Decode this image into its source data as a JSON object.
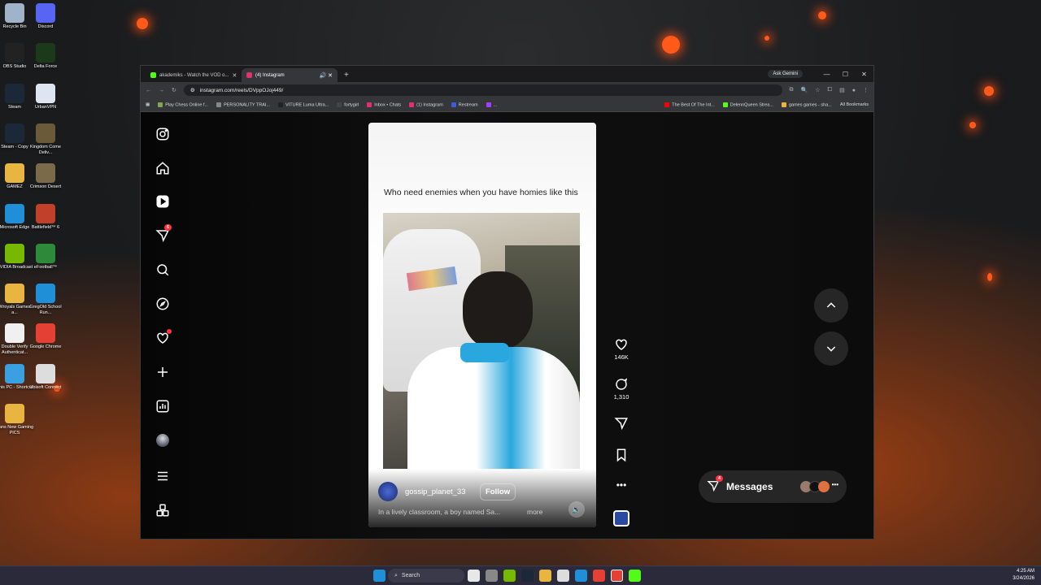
{
  "desktop": {
    "icons": [
      {
        "label": "Recycle Bin",
        "color": "#9fb4c8"
      },
      {
        "label": "Discord",
        "color": "#5865f2"
      },
      {
        "label": "OBS Studio",
        "color": "#222"
      },
      {
        "label": "Delta Force",
        "color": "#1a3a1a"
      },
      {
        "label": "Steam",
        "color": "#1b2838"
      },
      {
        "label": "UrbanVPN",
        "color": "#dde6f0"
      },
      {
        "label": "Steam - Copy",
        "color": "#1b2838"
      },
      {
        "label": "Kingdom Come Deliv...",
        "color": "#6b5a3a"
      },
      {
        "label": "GAMEZ",
        "color": "#e8b640"
      },
      {
        "label": "Crimson Desert",
        "color": "#7a6a4a"
      },
      {
        "label": "Microsoft Edge",
        "color": "#1f8fd8"
      },
      {
        "label": "Battlefield™ 6",
        "color": "#c0402a"
      },
      {
        "label": "NVIDIA Broadcast",
        "color": "#76b900"
      },
      {
        "label": "eFootball™",
        "color": "#2d8a3a"
      },
      {
        "label": "Wroyals Games a...",
        "color": "#e8b640"
      },
      {
        "label": "GregOld School Run...",
        "color": "#1f8fd8"
      },
      {
        "label": "Double Verify Authenticat...",
        "color": "#f0f0f0"
      },
      {
        "label": "Google Chrome",
        "color": "#e44134"
      },
      {
        "label": "This PC - Shortcut",
        "color": "#3aa0e0"
      },
      {
        "label": "Ubisoft Connect",
        "color": "#dddddd"
      },
      {
        "label": "Dans New Gaming PICS",
        "color": "#e8b640"
      }
    ]
  },
  "browser": {
    "tabs": [
      {
        "title": "akademiks - Watch the VOD o...",
        "active": false,
        "color": "#53fc18"
      },
      {
        "title": "(4) Instagram",
        "active": true,
        "color": "#e1306c"
      }
    ],
    "ask_gemini": "Ask Gemini",
    "url": "instagram.com/reels/DVppOJoj449/",
    "bookmarks": [
      {
        "label": "Play Chess Online f...",
        "color": "#7fa650"
      },
      {
        "label": "PERSONALITY TRAI...",
        "color": "#888"
      },
      {
        "label": "VITURE Luma Ultra...",
        "color": "#222"
      },
      {
        "label": "fortygirl",
        "color": "#444"
      },
      {
        "label": "Inbox • Chats",
        "color": "#e1306c"
      },
      {
        "label": "(1) Instagram",
        "color": "#e1306c"
      },
      {
        "label": "Restream",
        "color": "#3b5bdb"
      },
      {
        "label": "...",
        "color": "#a040ff"
      },
      {
        "label": "The Best Of The Int...",
        "color": "#ff0000"
      },
      {
        "label": "DelennQueen Strea...",
        "color": "#53fc18"
      },
      {
        "label": "games games - sha...",
        "color": "#e8b640"
      }
    ],
    "all_bookmarks": "All Bookmarks"
  },
  "instagram": {
    "nav_badge": "6",
    "reel": {
      "caption": "Who need enemies when you have homies like this",
      "username": "gossip_planet_33",
      "follow": "Follow",
      "description": "In a lively classroom, a boy named Sa...",
      "more": "more"
    },
    "actions": {
      "likes": "146K",
      "comments": "1,310"
    },
    "messages": {
      "label": "Messages",
      "badge": "4"
    }
  },
  "taskbar": {
    "search": "Search",
    "time": "4:25 AM",
    "date": "3/24/2026"
  }
}
